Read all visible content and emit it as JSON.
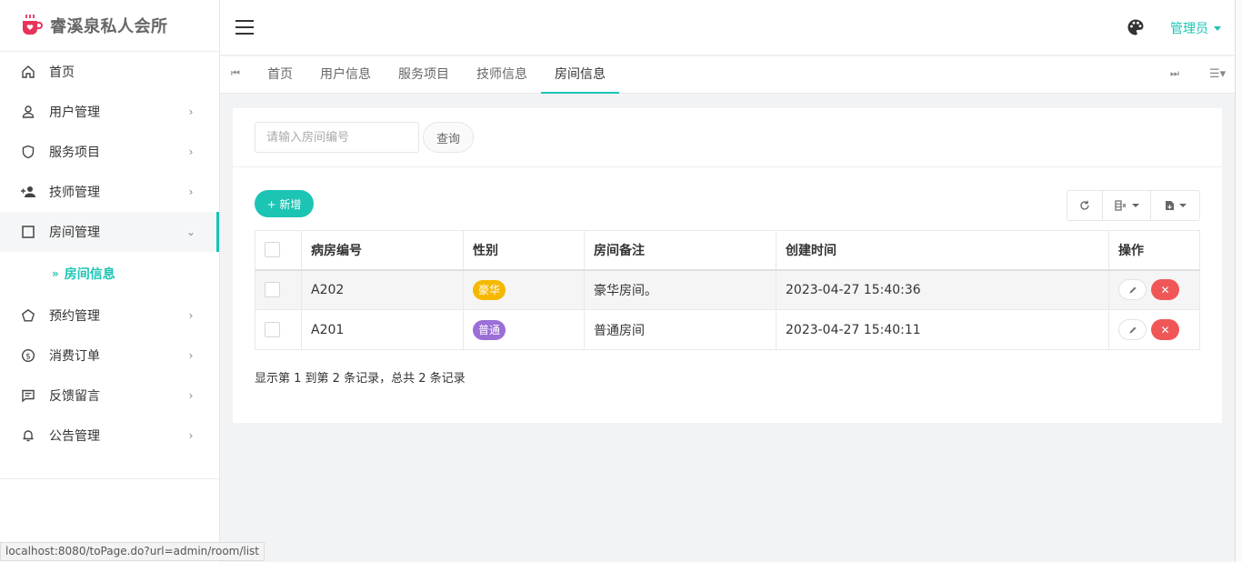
{
  "brand": {
    "title": "睿溪泉私人会所",
    "accent": "#1cc4b4",
    "icon_color": "#e8325a"
  },
  "sidebar": {
    "items": [
      {
        "label": "首页",
        "icon": "home-icon",
        "has_children": false
      },
      {
        "label": "用户管理",
        "icon": "user-icon",
        "has_children": true
      },
      {
        "label": "服务项目",
        "icon": "shield-icon",
        "has_children": true
      },
      {
        "label": "技师管理",
        "icon": "person-add-icon",
        "has_children": true
      },
      {
        "label": "房间管理",
        "icon": "square-icon",
        "has_children": true,
        "expanded": true
      },
      {
        "label": "预约管理",
        "icon": "pentagon-icon",
        "has_children": true
      },
      {
        "label": "消费订单",
        "icon": "coin-icon",
        "has_children": true
      },
      {
        "label": "反馈留言",
        "icon": "message-icon",
        "has_children": true
      },
      {
        "label": "公告管理",
        "icon": "bell-icon",
        "has_children": true
      }
    ],
    "submenu": {
      "label": "房间信息",
      "arrow": "»"
    }
  },
  "header": {
    "admin_label": "管理员"
  },
  "tabs": {
    "items": [
      "首页",
      "用户信息",
      "服务项目",
      "技师信息",
      "房间信息"
    ],
    "active_index": 4
  },
  "search": {
    "placeholder": "请输入房间编号",
    "button_label": "查询"
  },
  "toolbar": {
    "add_label": "+ 新增"
  },
  "table": {
    "columns": [
      "病房编号",
      "性别",
      "房间备注",
      "创建时间",
      "操作"
    ],
    "rows": [
      {
        "room_no": "A202",
        "type": "豪华",
        "type_color": "#f5b800",
        "note": "豪华房间。",
        "created": "2023-04-27 15:40:36"
      },
      {
        "room_no": "A201",
        "type": "普通",
        "type_color": "#9b6fd6",
        "note": "普通房间",
        "created": "2023-04-27 15:40:11"
      }
    ]
  },
  "summary": "显示第 1 到第 2 条记录，总共 2 条记录",
  "status_url": "localhost:8080/toPage.do?url=admin/room/list"
}
